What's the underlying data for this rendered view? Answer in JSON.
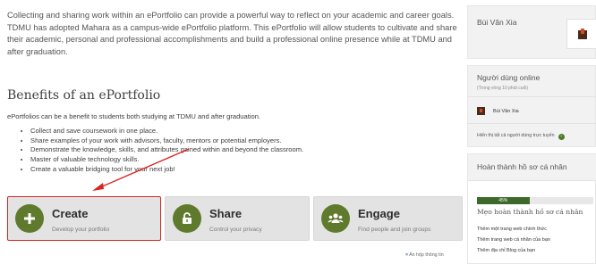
{
  "intro": {
    "text": "Collecting and sharing work within an ePortfolio can provide a powerful way to reflect on your academic and career goals.  TDMU has adopted Mahara as a campus-wide ePortfolio platform.  This ePortfolio will allow students to cultivate and share their academic, personal and professional accomplishments and build a professional online presence while at TDMU and after graduation."
  },
  "benefits": {
    "title": "Benefits of an ePortfolio",
    "subtitle": "ePortfolios can be a benefit to students both studying at TDMU and after graduation.",
    "items": [
      "Collect and save coursework in one place.",
      "Share examples of your work with advisors, faculty, mentors or potential employers.",
      "Demonstrate the knowledge, skills, and attributes gained within and beyond the classroom.",
      "Master of valuable technology skills.",
      "Create a valuable bridging tool for your next job!"
    ]
  },
  "tiles": [
    {
      "title": "Create",
      "subtitle": "Develop your portfolio",
      "icon": "plus-icon"
    },
    {
      "title": "Share",
      "subtitle": "Control your privacy",
      "icon": "lock-open-icon"
    },
    {
      "title": "Engage",
      "subtitle": "Find people and join groups",
      "icon": "people-icon"
    }
  ],
  "hide_info": {
    "icon": "close-icon",
    "label": "Ẩn hộp thông tin"
  },
  "sidebar": {
    "profile": {
      "name": "Bùi Văn Xia"
    },
    "online": {
      "title": "Người dùng online",
      "subtitle": "(Trong vòng 10 phút cuối)",
      "users": [
        "Bùi Văn Xia"
      ],
      "show_all": "Hiển thị tất cả người dùng trực tuyến"
    },
    "completion": {
      "title": "Hoàn thành hồ sơ cá nhân",
      "percent_label": "45%",
      "percent": 45,
      "tips_title": "Mẹo hoàn thành hồ sơ cá nhân",
      "tips": [
        "Thêm một trang web chính thức",
        "Thêm trang web cá nhân của bạn",
        "Thêm địa chỉ Blog của bạn"
      ]
    }
  },
  "colors": {
    "accent_green": "#5f7a2c",
    "progress_green": "#3d6a2b",
    "highlight_red": "#d9241f"
  }
}
